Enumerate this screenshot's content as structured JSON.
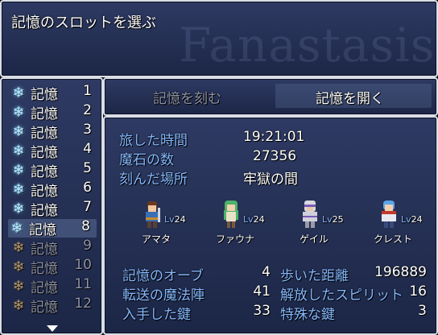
{
  "help": {
    "title": "記憶のスロットを選ぶ",
    "watermark": "Fanastasis"
  },
  "slots": [
    {
      "label": "記憶",
      "num": "1",
      "filled": true
    },
    {
      "label": "記憶",
      "num": "2",
      "filled": true
    },
    {
      "label": "記憶",
      "num": "3",
      "filled": true
    },
    {
      "label": "記憶",
      "num": "4",
      "filled": true
    },
    {
      "label": "記憶",
      "num": "5",
      "filled": true
    },
    {
      "label": "記憶",
      "num": "6",
      "filled": true
    },
    {
      "label": "記憶",
      "num": "7",
      "filled": true
    },
    {
      "label": "記憶",
      "num": "8",
      "filled": true,
      "selected": true
    },
    {
      "label": "記憶",
      "num": "9",
      "filled": false
    },
    {
      "label": "記憶",
      "num": "10",
      "filled": false
    },
    {
      "label": "記憶",
      "num": "11",
      "filled": false
    },
    {
      "label": "記憶",
      "num": "12",
      "filled": false
    }
  ],
  "commands": {
    "save": "記憶を刻む",
    "load": "記憶を開く",
    "save_enabled": false,
    "selected": "load"
  },
  "info": {
    "playtime_label": "旅した時間",
    "playtime": "19:21:01",
    "gold_label": "魔石の数",
    "gold": "27356",
    "location_label": "刻んだ場所",
    "location": "牢獄の間"
  },
  "party": [
    {
      "name": "アマタ",
      "level_prefix": "Lv",
      "level": "24",
      "icon": "swordsman-sprite"
    },
    {
      "name": "ファウナ",
      "level_prefix": "Lv",
      "level": "24",
      "icon": "green-haired-girl-sprite"
    },
    {
      "name": "ゲイル",
      "level_prefix": "Lv",
      "level": "25",
      "icon": "bandaged-warrior-sprite"
    },
    {
      "name": "クレスト",
      "level_prefix": "Lv",
      "level": "24",
      "icon": "blue-haired-knight-sprite"
    }
  ],
  "stats": [
    {
      "label": "記憶のオーブ",
      "value": "4"
    },
    {
      "label": "歩いた距離",
      "value": "196889"
    },
    {
      "label": "転送の魔法陣",
      "value": "41"
    },
    {
      "label": "解放したスピリット",
      "value": "16"
    },
    {
      "label": "入手した鍵",
      "value": "33"
    },
    {
      "label": "特殊な鍵",
      "value": "3"
    }
  ],
  "colors": {
    "label_blue": "#84b8ff",
    "window_top": "#2e3a63",
    "window_bottom": "#1c2646"
  }
}
